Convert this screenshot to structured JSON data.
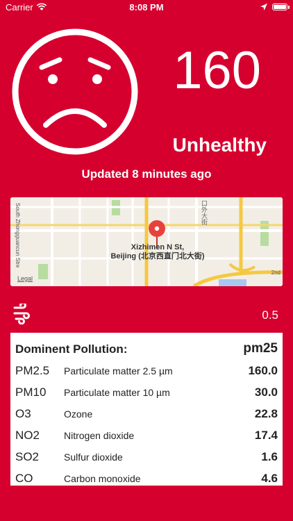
{
  "status_bar": {
    "carrier": "Carrier",
    "time": "8:08 PM"
  },
  "aqi": {
    "value": "160",
    "level": "Unhealthy",
    "updated": "Updated 8 minutes ago",
    "face_icon": "sad-face-icon"
  },
  "map": {
    "location_label_line1": "Xizhimen N St,",
    "location_label_line2": "Beijing (北京西直门北大街)",
    "street_left": "South Zhongguancun Stre",
    "street_cn": "口外大街",
    "road_right": "2nd",
    "legal": "Legal"
  },
  "wind": {
    "icon": "wind-icon",
    "value": "0.5"
  },
  "pollution": {
    "dominant_label": "Dominent Pollution:",
    "dominant_value": "pm25",
    "rows": [
      {
        "code": "PM2.5",
        "name": "Particulate matter 2.5 µm",
        "value": "160.0"
      },
      {
        "code": "PM10",
        "name": "Particulate matter 10 µm",
        "value": "30.0"
      },
      {
        "code": "O3",
        "name": "Ozone",
        "value": "22.8"
      },
      {
        "code": "NO2",
        "name": "Nitrogen dioxide",
        "value": "17.4"
      },
      {
        "code": "SO2",
        "name": "Sulfur dioxide",
        "value": "1.6"
      },
      {
        "code": "CO",
        "name": "Carbon monoxide",
        "value": "4.6"
      }
    ]
  },
  "colors": {
    "background": "#d6002f",
    "card": "#ffffff",
    "map_road_yellow": "#f5c842",
    "map_park_green": "#b7dca1",
    "map_pin": "#e8413b"
  }
}
